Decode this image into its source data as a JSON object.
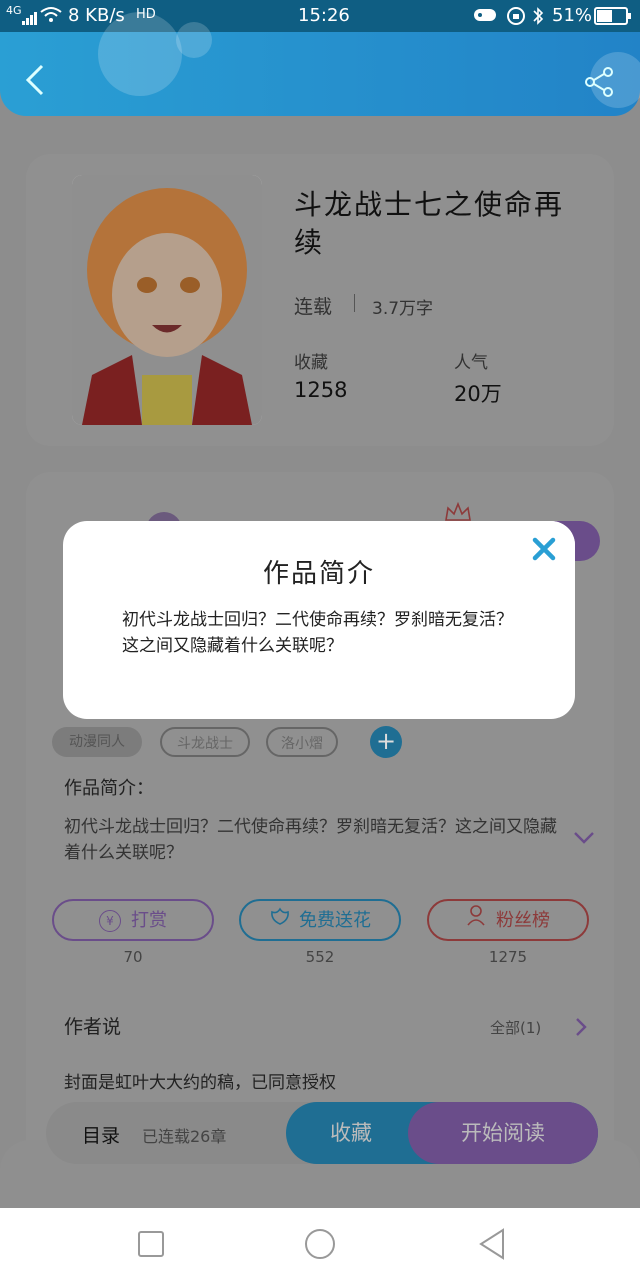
{
  "status_bar": {
    "network": "4G",
    "speed": "8 KB/s",
    "hd": "HD",
    "time": "15:26",
    "battery": "51%"
  },
  "book": {
    "title": "斗龙战士七之使命再续",
    "status": "连载",
    "word_count": "3.7万字",
    "favorites_label": "收藏",
    "favorites_value": "1258",
    "popularity_label": "人气",
    "popularity_value": "20万"
  },
  "tags": [
    "动漫同人",
    "斗龙战士",
    "洛小熠"
  ],
  "intro": {
    "label": "作品简介：",
    "text": "初代斗龙战士回归？二代使命再续？罗刹暗无复活？这之间又隐藏着什么关联呢？"
  },
  "actions": [
    {
      "label": "打赏",
      "count": "70",
      "icon": "yen-icon",
      "color": "#8a5cc2"
    },
    {
      "label": "免费送花",
      "count": "552",
      "icon": "flower-icon",
      "color": "#2a9fd4"
    },
    {
      "label": "粉丝榜",
      "count": "1275",
      "icon": "fans-icon",
      "color": "#d9534f"
    }
  ],
  "author_say": {
    "title": "作者说",
    "all_label": "全部(1)",
    "text": "封面是虹叶大大约的稿，已同意授权"
  },
  "bottom_bar": {
    "toc_label": "目录",
    "chapters": "已连载26章",
    "collect": "收藏",
    "read": "开始阅读"
  },
  "modal": {
    "title": "作品简介",
    "text": "初代斗龙战士回归？二代使命再续？罗刹暗无复活？这之间又隐藏着什么关联呢？"
  },
  "colors": {
    "accent_blue": "#2a9fd4",
    "accent_purple": "#8a5cc2",
    "accent_red": "#d9534f"
  }
}
